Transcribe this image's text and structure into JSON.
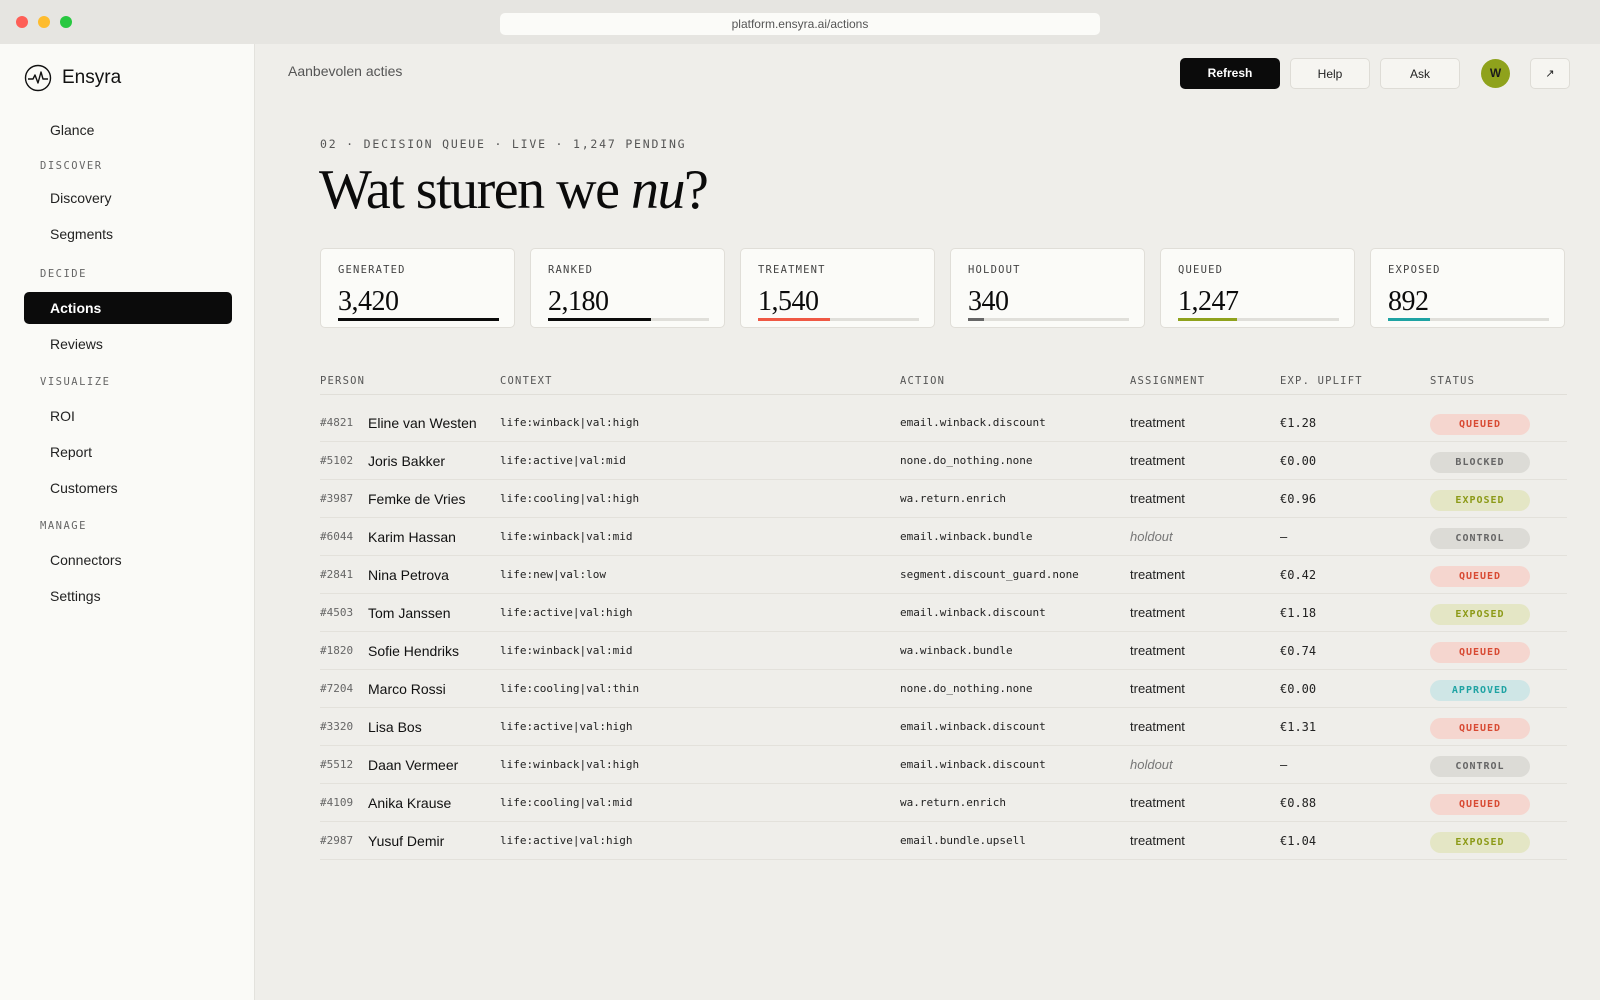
{
  "browser": {
    "url": "platform.ensyra.ai/actions"
  },
  "brand": {
    "name": "Ensyra",
    "icon": "pulse-logo-icon"
  },
  "sidebar": {
    "top_item": "Glance",
    "sections": [
      {
        "title": "DISCOVER",
        "items": [
          "Discovery",
          "Segments"
        ]
      },
      {
        "title": "DECIDE",
        "items": [
          "Actions",
          "Reviews"
        ]
      },
      {
        "title": "VISUALIZE",
        "items": [
          "ROI",
          "Report",
          "Customers"
        ]
      },
      {
        "title": "MANAGE",
        "items": [
          "Connectors",
          "Settings"
        ]
      }
    ],
    "active": "Actions"
  },
  "header": {
    "breadcrumb": "Aanbevolen acties",
    "refresh_label": "Refresh",
    "help_label": "Help",
    "ask_label": "Ask",
    "avatar_initial": "W",
    "external_icon": "↗"
  },
  "hero": {
    "eyebrow": "02 · DECISION QUEUE · LIVE · 1,247 PENDING",
    "title_before": "Wat sturen we ",
    "title_italic": "nu",
    "title_after": "?"
  },
  "stats": [
    {
      "label": "GENERATED",
      "value": "3,420",
      "fill": 1.0,
      "color": "#0b0b0b"
    },
    {
      "label": "RANKED",
      "value": "2,180",
      "fill": 0.637,
      "color": "#0b0b0b"
    },
    {
      "label": "TREATMENT",
      "value": "1,540",
      "fill": 0.45,
      "color": "#ef5844"
    },
    {
      "label": "HOLDOUT",
      "value": "340",
      "fill": 0.099,
      "color": "#666666"
    },
    {
      "label": "QUEUED",
      "value": "1,247",
      "fill": 0.365,
      "color": "#8fa21c"
    },
    {
      "label": "EXPOSED",
      "value": "892",
      "fill": 0.261,
      "color": "#1fa3a3"
    }
  ],
  "table": {
    "columns": [
      "PERSON",
      "CONTEXT",
      "ACTION",
      "ASSIGNMENT",
      "EXP. UPLIFT",
      "STATUS"
    ],
    "rows": [
      {
        "id": "#4821",
        "name": "Eline van Westen",
        "context": "life:winback|val:high",
        "action": "email.winback.discount",
        "assignment": "treatment",
        "uplift": "€1.28",
        "status": "QUEUED"
      },
      {
        "id": "#5102",
        "name": "Joris Bakker",
        "context": "life:active|val:mid",
        "action": "none.do_nothing.none",
        "assignment": "treatment",
        "uplift": "€0.00",
        "status": "BLOCKED"
      },
      {
        "id": "#3987",
        "name": "Femke de Vries",
        "context": "life:cooling|val:high",
        "action": "wa.return.enrich",
        "assignment": "treatment",
        "uplift": "€0.96",
        "status": "EXPOSED"
      },
      {
        "id": "#6044",
        "name": "Karim Hassan",
        "context": "life:winback|val:mid",
        "action": "email.winback.bundle",
        "assignment": "holdout",
        "uplift": "—",
        "status": "CONTROL"
      },
      {
        "id": "#2841",
        "name": "Nina Petrova",
        "context": "life:new|val:low",
        "action": "segment.discount_guard.none",
        "assignment": "treatment",
        "uplift": "€0.42",
        "status": "QUEUED"
      },
      {
        "id": "#4503",
        "name": "Tom Janssen",
        "context": "life:active|val:high",
        "action": "email.winback.discount",
        "assignment": "treatment",
        "uplift": "€1.18",
        "status": "EXPOSED"
      },
      {
        "id": "#1820",
        "name": "Sofie Hendriks",
        "context": "life:winback|val:mid",
        "action": "wa.winback.bundle",
        "assignment": "treatment",
        "uplift": "€0.74",
        "status": "QUEUED"
      },
      {
        "id": "#7204",
        "name": "Marco Rossi",
        "context": "life:cooling|val:thin",
        "action": "none.do_nothing.none",
        "assignment": "treatment",
        "uplift": "€0.00",
        "status": "APPROVED"
      },
      {
        "id": "#3320",
        "name": "Lisa Bos",
        "context": "life:active|val:high",
        "action": "email.winback.discount",
        "assignment": "treatment",
        "uplift": "€1.31",
        "status": "QUEUED"
      },
      {
        "id": "#5512",
        "name": "Daan Vermeer",
        "context": "life:winback|val:high",
        "action": "email.winback.discount",
        "assignment": "holdout",
        "uplift": "—",
        "status": "CONTROL"
      },
      {
        "id": "#4109",
        "name": "Anika Krause",
        "context": "life:cooling|val:mid",
        "action": "wa.return.enrich",
        "assignment": "treatment",
        "uplift": "€0.88",
        "status": "QUEUED"
      },
      {
        "id": "#2987",
        "name": "Yusuf Demir",
        "context": "life:active|val:high",
        "action": "email.bundle.upsell",
        "assignment": "treatment",
        "uplift": "€1.04",
        "status": "EXPOSED"
      }
    ]
  }
}
